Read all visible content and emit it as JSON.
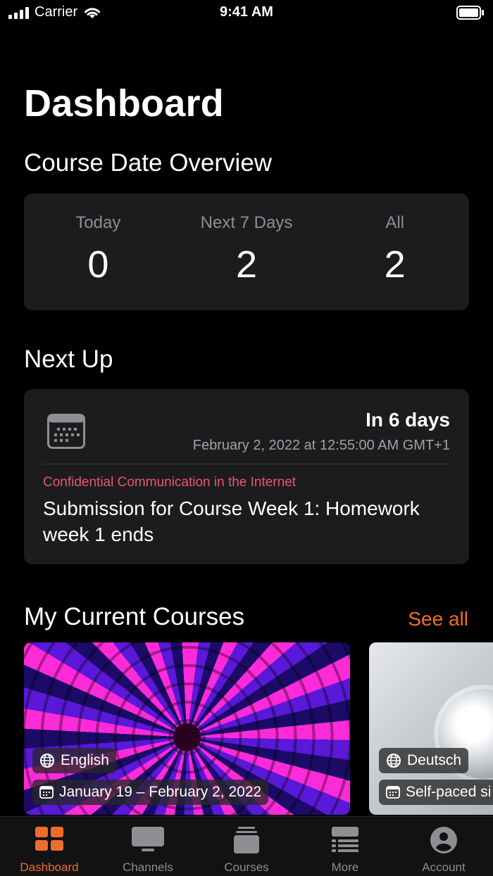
{
  "status_bar": {
    "carrier": "Carrier",
    "time": "9:41 AM"
  },
  "page_title": "Dashboard",
  "overview": {
    "heading": "Course Date Overview",
    "columns": [
      {
        "label": "Today",
        "value": "0"
      },
      {
        "label": "Next 7 Days",
        "value": "2"
      },
      {
        "label": "All",
        "value": "2"
      }
    ]
  },
  "next_up": {
    "heading": "Next Up",
    "when": "In 6 days",
    "date": "February 2, 2022 at 12:55:00 AM GMT+1",
    "course": "Confidential Communication in the Internet",
    "title": "Submission for Course Week 1: Homework week 1 ends"
  },
  "courses": {
    "heading": "My Current Courses",
    "see_all": "See all",
    "items": [
      {
        "language": "English",
        "dates": "January 19 – February 2, 2022"
      },
      {
        "language": "Deutsch",
        "dates": "Self-paced si"
      }
    ]
  },
  "tabs": [
    {
      "label": "Dashboard",
      "icon": "dashboard-grid-icon"
    },
    {
      "label": "Channels",
      "icon": "tv-icon"
    },
    {
      "label": "Courses",
      "icon": "stack-icon"
    },
    {
      "label": "More",
      "icon": "list-icon"
    },
    {
      "label": "Account",
      "icon": "person-circle-icon"
    }
  ],
  "colors": {
    "accent": "#ef6c2b",
    "course_label": "#e8566f",
    "card_bg": "#1c1c1e"
  }
}
